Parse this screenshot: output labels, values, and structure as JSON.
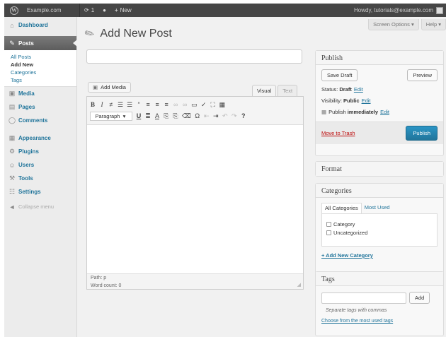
{
  "adminbar": {
    "wp_logo": "W",
    "site_name": "Example.com",
    "updates_count": "1",
    "new_label": "New",
    "howdy": "Howdy, tutorials@example.com"
  },
  "sidebar": {
    "dashboard": "Dashboard",
    "posts": "Posts",
    "submenu": [
      "All Posts",
      "Add New",
      "Categories",
      "Tags"
    ],
    "items": [
      "Media",
      "Pages",
      "Comments",
      "Appearance",
      "Plugins",
      "Users",
      "Tools",
      "Settings"
    ],
    "collapse": "Collapse menu"
  },
  "header": {
    "screen_options": "Screen Options ▾",
    "help": "Help ▾",
    "title": "Add New Post"
  },
  "editor": {
    "add_media": "Add Media",
    "tab_visual": "Visual",
    "tab_text": "Text",
    "format_select": "Paragraph",
    "path": "Path: p",
    "word_count": "Word count: 0"
  },
  "publish": {
    "title": "Publish",
    "save_draft": "Save Draft",
    "preview": "Preview",
    "status_label": "Status:",
    "status_value": "Draft",
    "visibility_label": "Visibility:",
    "visibility_value": "Public",
    "publish_label": "Publish",
    "publish_value": "immediately",
    "edit": "Edit",
    "trash": "Move to Trash",
    "publish_button": "Publish"
  },
  "format": {
    "title": "Format"
  },
  "categories": {
    "title": "Categories",
    "tab_all": "All Categories",
    "tab_used": "Most Used",
    "items": [
      "Category",
      "Uncategorized"
    ],
    "add_new": "+ Add New Category"
  },
  "tags": {
    "title": "Tags",
    "add_button": "Add",
    "hint": "Separate tags with commas",
    "choose": "Choose from the most used tags"
  }
}
